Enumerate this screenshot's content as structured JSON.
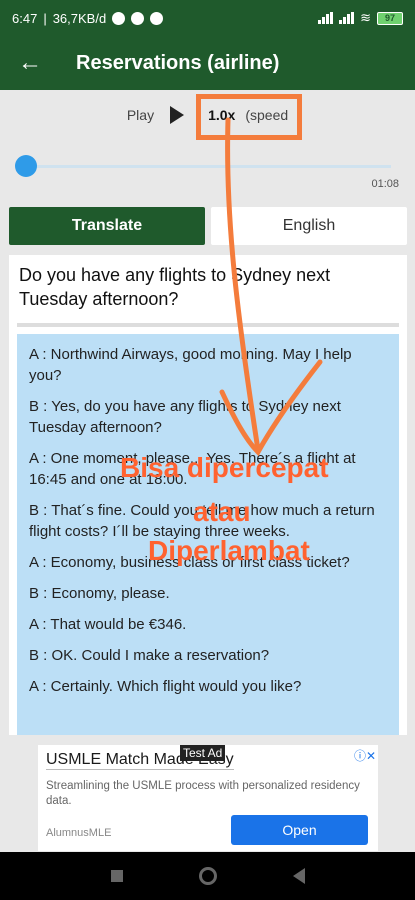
{
  "status": {
    "time": "6:47",
    "net": "36,7KB/d",
    "battery": "97"
  },
  "appbar": {
    "title": "Reservations (airline)"
  },
  "player": {
    "play_label": "Play",
    "speed": "1.0x",
    "speed_label": "(speed",
    "duration": "01:08",
    "progress": 0.0
  },
  "buttons": {
    "translate": "Translate",
    "english": "English"
  },
  "question": "Do you have any flights to Sydney next Tuesday afternoon?",
  "dialog": [
    "A : Northwind Airways, good morning. May I help you?",
    "B : Yes, do you have any flights to Sydney next Tuesday afternoon?",
    "A : One moment, please... Yes. There´s a flight at 16:45 and one at 18:00.",
    "B : That´s fine. Could you tell me how much a return flight costs? I´ll be staying three weeks.",
    "A : Economy, business class or first class ticket?",
    "B : Economy, please.",
    "A : That would be €346.",
    "B : OK. Could I make a reservation?",
    "A : Certainly. Which flight would you like?"
  ],
  "annotation": {
    "line1": "Bisa dipercepat",
    "line2": "atau",
    "line3": "Diperlambat",
    "color": "#f47c3c"
  },
  "ad": {
    "tag": "Test Ad",
    "title": "USMLE Match Made Easy",
    "desc": "Streamlining the USMLE process with personalized residency data.",
    "brand": "AlumnusMLE",
    "cta": "Open"
  }
}
